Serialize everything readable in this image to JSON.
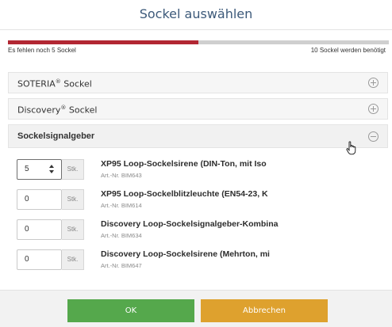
{
  "dialog": {
    "title": "Sockel auswählen"
  },
  "progress": {
    "fraction": 0.5,
    "missing_label": "Es fehlen noch 5 Sockel",
    "required_label": "10 Sockel werden benötigt",
    "fill_color": "#b22733",
    "track_color": "#cfcfcf"
  },
  "sections": [
    {
      "label": "SOTERIA",
      "trademark": "®",
      "suffix": " Sockel",
      "icon": "plus-circle-icon",
      "expanded": false
    },
    {
      "label": "Discovery",
      "trademark": "®",
      "suffix": " Sockel",
      "icon": "plus-circle-icon",
      "expanded": false
    },
    {
      "label": "Sockelsignalgeber",
      "trademark": "",
      "suffix": "",
      "icon": "minus-circle-icon",
      "expanded": true
    }
  ],
  "products": [
    {
      "qty": "5",
      "unit": "Stk.",
      "name": "XP95 Loop-Sockelsirene (DIN-Ton, mit Iso",
      "article": "Art.-Nr. BIM643"
    },
    {
      "qty": "0",
      "unit": "Stk.",
      "name": "XP95 Loop-Sockelblitzleuchte (EN54-23, K",
      "article": "Art.-Nr. BIM614"
    },
    {
      "qty": "0",
      "unit": "Stk.",
      "name": "Discovery Loop-Sockelsignalgeber-Kombina",
      "article": "Art.-Nr. BIM634"
    },
    {
      "qty": "0",
      "unit": "Stk.",
      "name": "Discovery Loop-Sockelsirene (Mehrton, mi",
      "article": "Art.-Nr. BIM647"
    }
  ],
  "buttons": {
    "ok_label": "OK",
    "cancel_label": "Abbrechen",
    "ok_color": "#55a84c",
    "cancel_color": "#dea12e"
  }
}
